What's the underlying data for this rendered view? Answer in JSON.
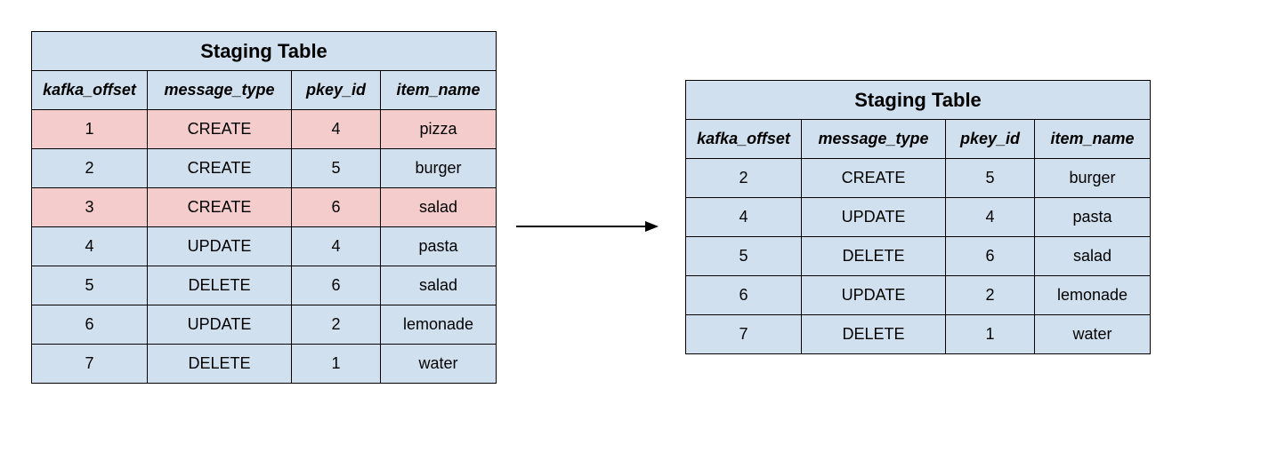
{
  "colors": {
    "cell_bg": "#d0e0ee",
    "highlight_bg": "#f4cccc",
    "border": "#000000"
  },
  "left_table": {
    "title": "Staging Table",
    "columns": [
      "kafka_offset",
      "message_type",
      "pkey_id",
      "item_name"
    ],
    "rows": [
      {
        "highlight": true,
        "cells": [
          "1",
          "CREATE",
          "4",
          "pizza"
        ]
      },
      {
        "highlight": false,
        "cells": [
          "2",
          "CREATE",
          "5",
          "burger"
        ]
      },
      {
        "highlight": true,
        "cells": [
          "3",
          "CREATE",
          "6",
          "salad"
        ]
      },
      {
        "highlight": false,
        "cells": [
          "4",
          "UPDATE",
          "4",
          "pasta"
        ]
      },
      {
        "highlight": false,
        "cells": [
          "5",
          "DELETE",
          "6",
          "salad"
        ]
      },
      {
        "highlight": false,
        "cells": [
          "6",
          "UPDATE",
          "2",
          "lemonade"
        ]
      },
      {
        "highlight": false,
        "cells": [
          "7",
          "DELETE",
          "1",
          "water"
        ]
      }
    ]
  },
  "right_table": {
    "title": "Staging Table",
    "columns": [
      "kafka_offset",
      "message_type",
      "pkey_id",
      "item_name"
    ],
    "rows": [
      {
        "highlight": false,
        "cells": [
          "2",
          "CREATE",
          "5",
          "burger"
        ]
      },
      {
        "highlight": false,
        "cells": [
          "4",
          "UPDATE",
          "4",
          "pasta"
        ]
      },
      {
        "highlight": false,
        "cells": [
          "5",
          "DELETE",
          "6",
          "salad"
        ]
      },
      {
        "highlight": false,
        "cells": [
          "6",
          "UPDATE",
          "2",
          "lemonade"
        ]
      },
      {
        "highlight": false,
        "cells": [
          "7",
          "DELETE",
          "1",
          "water"
        ]
      }
    ]
  }
}
